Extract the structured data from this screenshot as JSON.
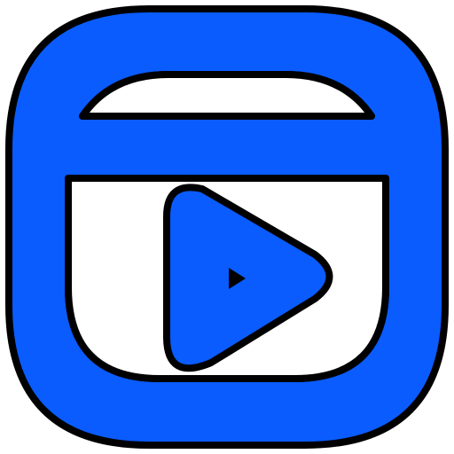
{
  "icon": {
    "name": "video-player-icon",
    "colors": {
      "primary": "#0a5cff",
      "outline": "#000000",
      "background": "#ffffff"
    },
    "parts": {
      "frame": "rounded-square-frame",
      "top_bar": "title-bar",
      "screen": "video-screen",
      "play_button": "play-icon",
      "inner_glyph": "small-play-icon"
    }
  }
}
